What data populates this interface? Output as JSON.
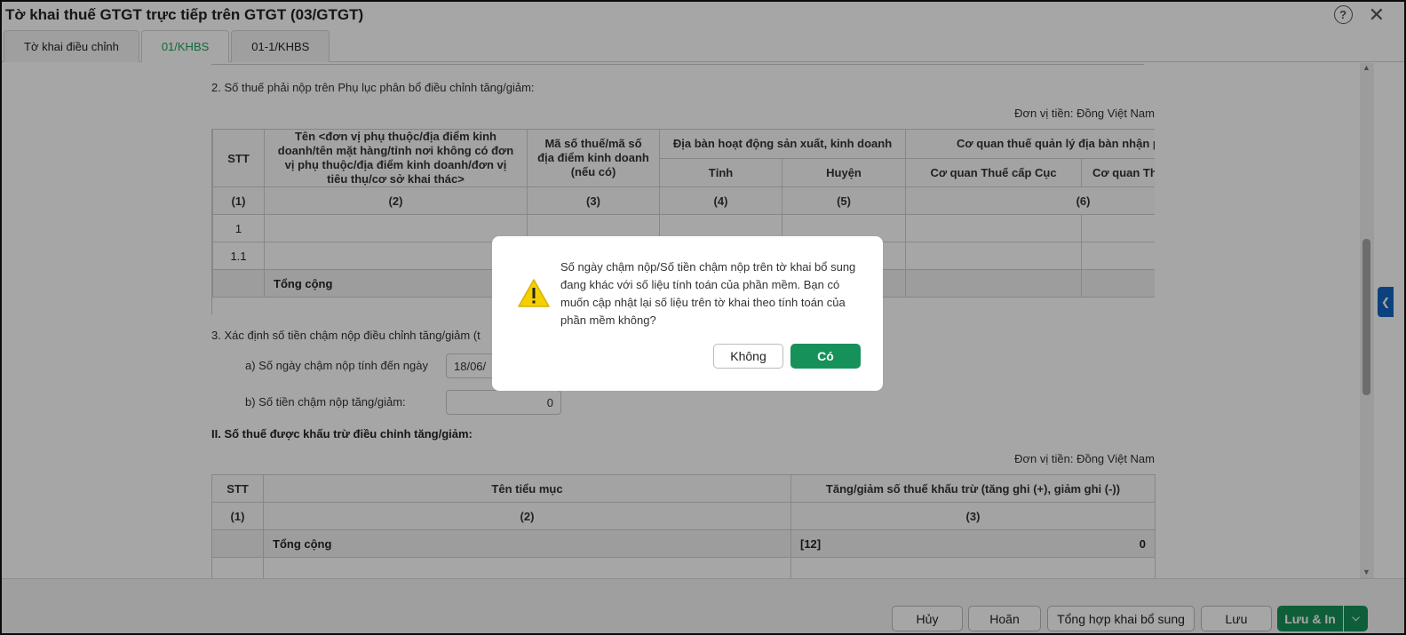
{
  "window": {
    "title": "Tờ khai thuế GTGT trực tiếp trên GTGT (03/GTGT)"
  },
  "tabs": [
    {
      "label": "Tờ khai điều chỉnh"
    },
    {
      "label": "01/KHBS"
    },
    {
      "label": "01-1/KHBS"
    }
  ],
  "section2": {
    "title": "2. Số thuế phải nộp trên Phụ lục phân bổ điều chỉnh tăng/giảm:",
    "unit": "Đơn vị tiền: Đồng Việt Nam",
    "headers": {
      "stt": "STT",
      "name": "Tên <đơn vị phụ thuộc/địa điểm kinh doanh/tên mặt hàng/tỉnh nơi không có đơn vị phụ thuộc/địa điểm kinh doanh/đơn vị tiêu thụ/cơ sở khai thác>",
      "mst": "Mã số thuế/mã số địa điểm kinh doanh (nếu có)",
      "diaban": "Địa bàn hoạt động sản xuất, kinh doanh",
      "tinh": "Tỉnh",
      "huyen": "Huyện",
      "coquan": "Cơ quan thuế quản lý địa bàn nhận p",
      "cqcuc": "Cơ quan Thuế cấp Cục",
      "cqth": "Cơ quan Th"
    },
    "col_nums": [
      "(1)",
      "(2)",
      "(3)",
      "(4)",
      "(5)",
      "(6)"
    ],
    "rows": [
      {
        "stt": "1"
      },
      {
        "stt": "1.1"
      }
    ],
    "total_label": "Tổng cộng"
  },
  "section3": {
    "title": "3. Xác định số tiền chậm nộp điều chỉnh tăng/giảm (t",
    "a_label": "a) Số ngày chậm nộp tính đến ngày",
    "a_value": "18/06/",
    "b_label": "b) Số tiền chậm nộp tăng/giảm:",
    "b_value": "0"
  },
  "sectionII": {
    "title": "II. Số thuế được khấu trừ điều chỉnh tăng/giảm:",
    "unit": "Đơn vị tiền: Đồng Việt Nam",
    "headers": {
      "stt": "STT",
      "name": "Tên tiểu mục",
      "change": "Tăng/giảm số thuế khấu trừ (tăng ghi (+), giảm ghi (-))"
    },
    "col_nums": [
      "(1)",
      "(2)",
      "(3)"
    ],
    "total_label": "Tổng cộng",
    "total_code": "[12]",
    "total_value": "0"
  },
  "footer": {
    "huy": "Hủy",
    "hoan": "Hoãn",
    "tonghop": "Tổng hợp khai bổ sung",
    "luu": "Lưu",
    "luuin": "Lưu & In"
  },
  "dialog": {
    "message": "Số ngày chậm nộp/Số tiền chậm nộp trên tờ khai bổ sung đang khác với số liệu tính toán của phần mềm. Bạn có muốn cập nhật lại số liệu trên tờ khai theo tính toán của phần mềm không?",
    "no_label": "Không",
    "yes_label": "Có"
  },
  "colors": {
    "accent": "#17915a",
    "side_handle": "#1565c0",
    "warning": "#f5d000"
  }
}
